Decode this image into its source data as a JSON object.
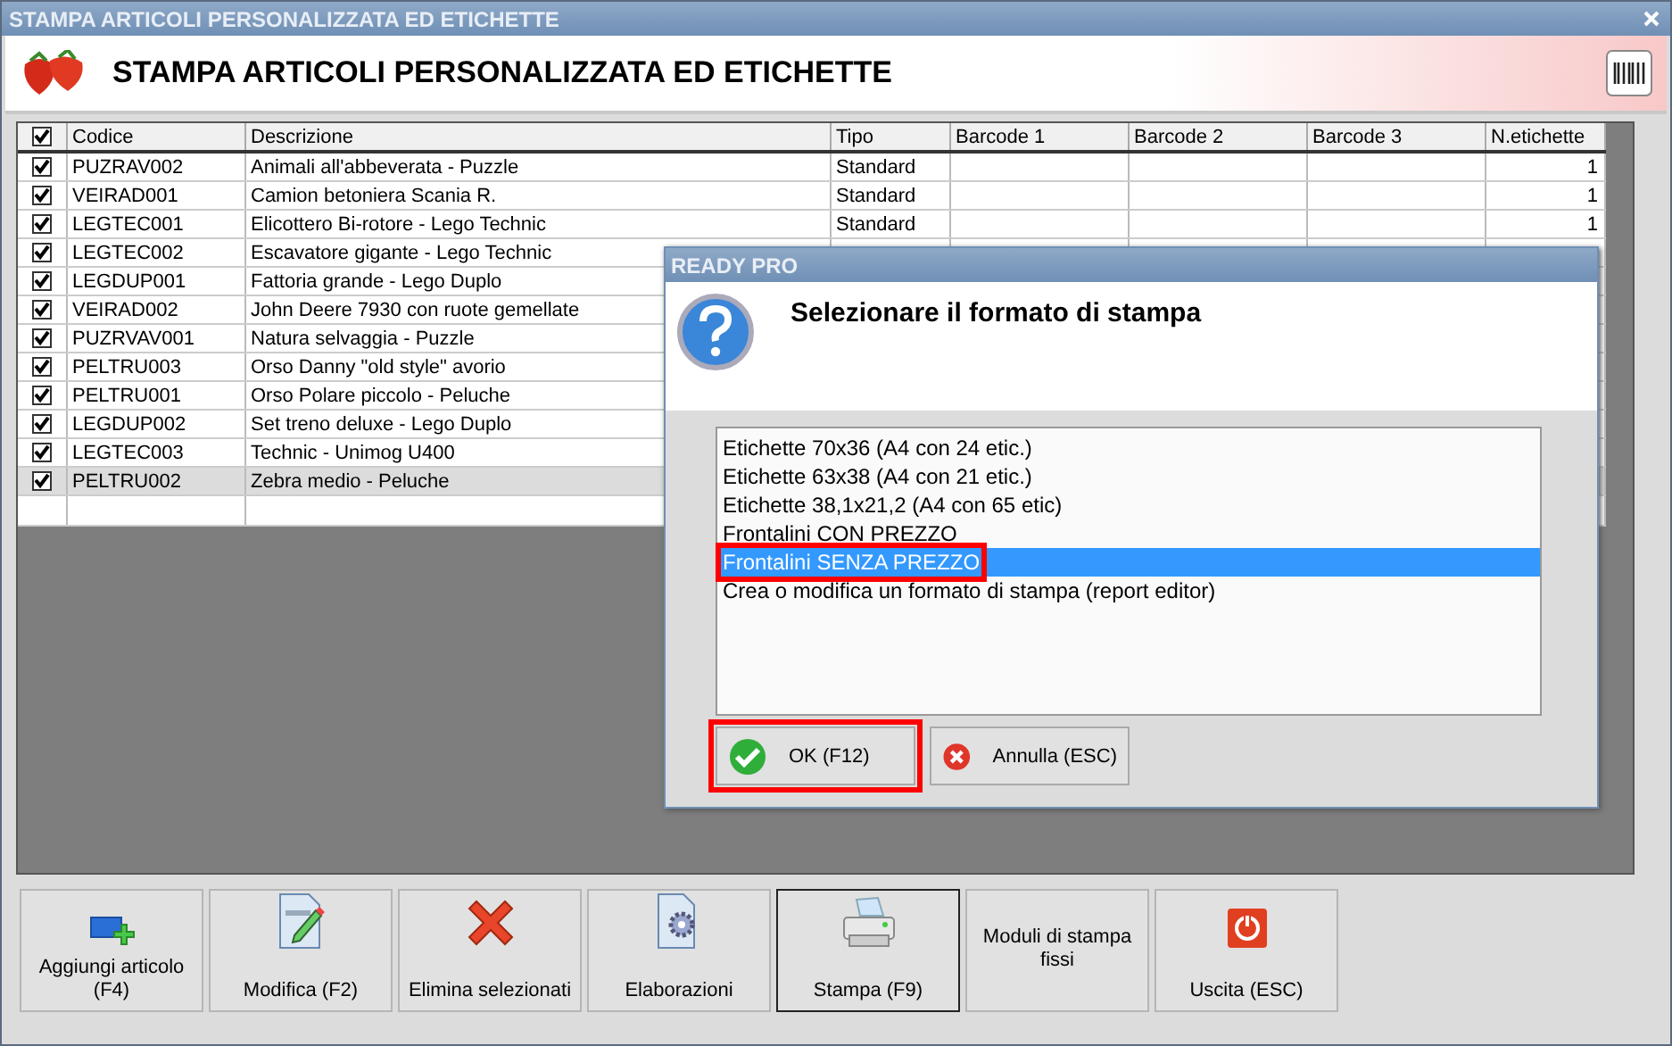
{
  "window": {
    "title": "STAMPA ARTICOLI PERSONALIZZATA ED ETICHETTE"
  },
  "header": {
    "title": "STAMPA ARTICOLI PERSONALIZZATA ED ETICHETTE"
  },
  "table": {
    "select_all_checked": true,
    "columns": [
      "Codice",
      "Descrizione",
      "Tipo",
      "Barcode 1",
      "Barcode 2",
      "Barcode 3",
      "N.etichette"
    ],
    "rows": [
      {
        "checked": true,
        "selected": false,
        "codice": "PUZRAV002",
        "descrizione": "Animali all'abbeverata - Puzzle",
        "tipo": "Standard",
        "n": "1"
      },
      {
        "checked": true,
        "selected": false,
        "codice": "VEIRAD001",
        "descrizione": "Camion betoniera Scania R.",
        "tipo": "Standard",
        "n": "1"
      },
      {
        "checked": true,
        "selected": false,
        "codice": "LEGTEC001",
        "descrizione": "Elicottero Bi-rotore - Lego Technic",
        "tipo": "Standard",
        "n": "1"
      },
      {
        "checked": true,
        "selected": false,
        "codice": "LEGTEC002",
        "descrizione": "Escavatore gigante - Lego Technic"
      },
      {
        "checked": true,
        "selected": false,
        "codice": "LEGDUP001",
        "descrizione": "Fattoria grande - Lego Duplo"
      },
      {
        "checked": true,
        "selected": false,
        "codice": "VEIRAD002",
        "descrizione": "John Deere 7930 con ruote gemellate"
      },
      {
        "checked": true,
        "selected": false,
        "codice": "PUZRVAV001",
        "descrizione": "Natura selvaggia - Puzzle"
      },
      {
        "checked": true,
        "selected": false,
        "codice": "PELTRU003",
        "descrizione": "Orso Danny \"old style\" avorio"
      },
      {
        "checked": true,
        "selected": false,
        "codice": "PELTRU001",
        "descrizione": "Orso Polare piccolo - Peluche"
      },
      {
        "checked": true,
        "selected": false,
        "codice": "LEGDUP002",
        "descrizione": "Set treno deluxe - Lego Duplo"
      },
      {
        "checked": true,
        "selected": false,
        "codice": "LEGTEC003",
        "descrizione": "Technic - Unimog U400"
      },
      {
        "checked": true,
        "selected": true,
        "codice": "PELTRU002",
        "descrizione": "Zebra medio - Peluche"
      }
    ]
  },
  "dialog": {
    "title": "READY PRO",
    "message": "Selezionare il formato di stampa",
    "options": [
      {
        "label": "Etichette 70x36 (A4 con 24 etic.)",
        "selected": false,
        "highlighted": false
      },
      {
        "label": "Etichette 63x38 (A4 con 21 etic.)",
        "selected": false,
        "highlighted": false
      },
      {
        "label": "Etichette 38,1x21,2 (A4 con 65 etic)",
        "selected": false,
        "highlighted": false
      },
      {
        "label": "Frontalini CON PREZZO",
        "selected": false,
        "highlighted": false
      },
      {
        "label": "Frontalini SENZA PREZZO",
        "selected": true,
        "highlighted": true
      },
      {
        "label": "Crea o modifica un formato di stampa (report editor)",
        "selected": false,
        "highlighted": false
      }
    ],
    "buttons": [
      {
        "kind": "ok",
        "label": "OK (F12)",
        "highlighted": true
      },
      {
        "kind": "cancel",
        "label": "Annulla (ESC)",
        "highlighted": false
      }
    ]
  },
  "toolbar": [
    {
      "kind": "add",
      "label": "Aggiungi articolo (F4)",
      "focused": false
    },
    {
      "kind": "edit",
      "label": "Modifica (F2)",
      "focused": false
    },
    {
      "kind": "delete",
      "label": "Elimina selezionati",
      "focused": false
    },
    {
      "kind": "process",
      "label": "Elaborazioni",
      "focused": false
    },
    {
      "kind": "print",
      "label": "Stampa (F9)",
      "focused": true
    },
    {
      "kind": "none",
      "label": "Moduli di stampa fissi",
      "focused": false
    },
    {
      "kind": "exit",
      "label": "Uscita (ESC)",
      "focused": false
    }
  ]
}
